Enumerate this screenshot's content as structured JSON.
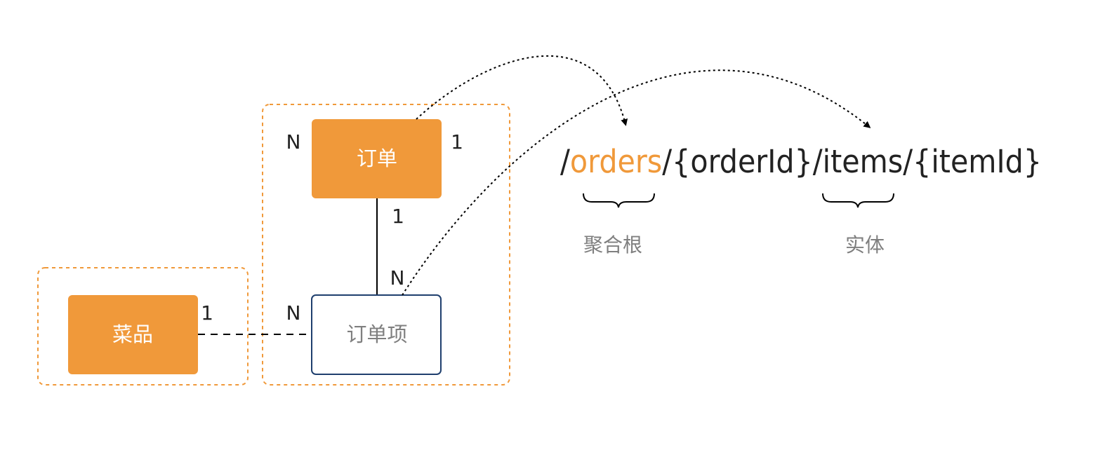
{
  "colors": {
    "accent": "#f0993a",
    "border_blue": "#1f3f6e",
    "text_dark": "#222222",
    "text_gray": "#7f7f7f",
    "white": "#ffffff"
  },
  "nodes": {
    "dish": "菜品",
    "order": "订单",
    "order_item": "订单项"
  },
  "cardinalities": {
    "order_left": "N",
    "order_right": "1",
    "order_bottom": "1",
    "order_item_top": "N",
    "order_item_left": "N",
    "dish_right": "1"
  },
  "uri": {
    "slash1": "/",
    "orders": "orders",
    "rest": "/{orderId}/items/{itemId}"
  },
  "captions": {
    "aggregate_root": "聚合根",
    "entity": "实体"
  }
}
